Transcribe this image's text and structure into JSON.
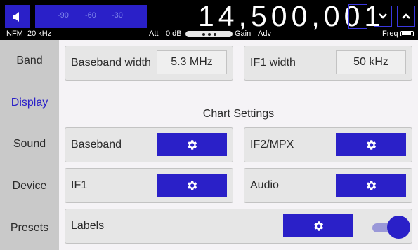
{
  "topbar": {
    "mode": "NFM",
    "bandwidth": "20 kHz",
    "meter_ticks": [
      "-90",
      "-60",
      "-30"
    ],
    "frequency": "14,500,001",
    "att_label": "Att",
    "att_value": "0 dB",
    "gain_label": "Gain",
    "adv_label": "Adv",
    "freq_label": "Freq"
  },
  "sidebar": {
    "items": [
      {
        "label": "Band"
      },
      {
        "label": "Display",
        "active": true
      },
      {
        "label": "Sound"
      },
      {
        "label": "Device"
      },
      {
        "label": "Presets"
      }
    ]
  },
  "main": {
    "baseband_width": {
      "label": "Baseband width",
      "value": "5.3 MHz"
    },
    "if1_width": {
      "label": "IF1 width",
      "value": "50 kHz"
    },
    "chart_settings_title": "Chart Settings",
    "charts": [
      {
        "label": "Baseband"
      },
      {
        "label": "IF2/MPX"
      },
      {
        "label": "IF1"
      },
      {
        "label": "Audio"
      }
    ],
    "labels": {
      "label": "Labels",
      "enabled": true
    }
  },
  "colors": {
    "accent": "#2a20c8",
    "sidebar": "#c9c9c9",
    "topbar": "#000000"
  },
  "icons": {
    "speaker": "speaker-icon",
    "gear": "gear-icon",
    "up": "chevron-up-icon",
    "down": "chevron-down-icon",
    "battery": "battery-icon"
  }
}
